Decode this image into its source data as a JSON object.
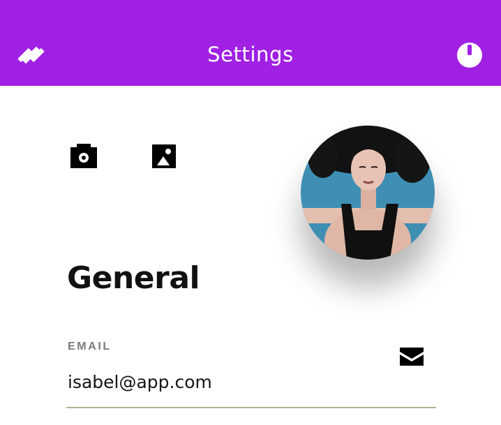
{
  "header": {
    "title": "Settings",
    "background_color": "#a020e4",
    "menu_icon": "hamburger-slash-icon",
    "power_icon": "power-icon"
  },
  "profile": {
    "camera_icon": "camera-icon",
    "image_icon": "image-icon",
    "avatar": "profile-photo"
  },
  "section": {
    "title": "General"
  },
  "email_field": {
    "label": "EMAIL",
    "value": "isabel@app.com",
    "icon": "mail-icon",
    "underline_color": "#b7b294"
  }
}
